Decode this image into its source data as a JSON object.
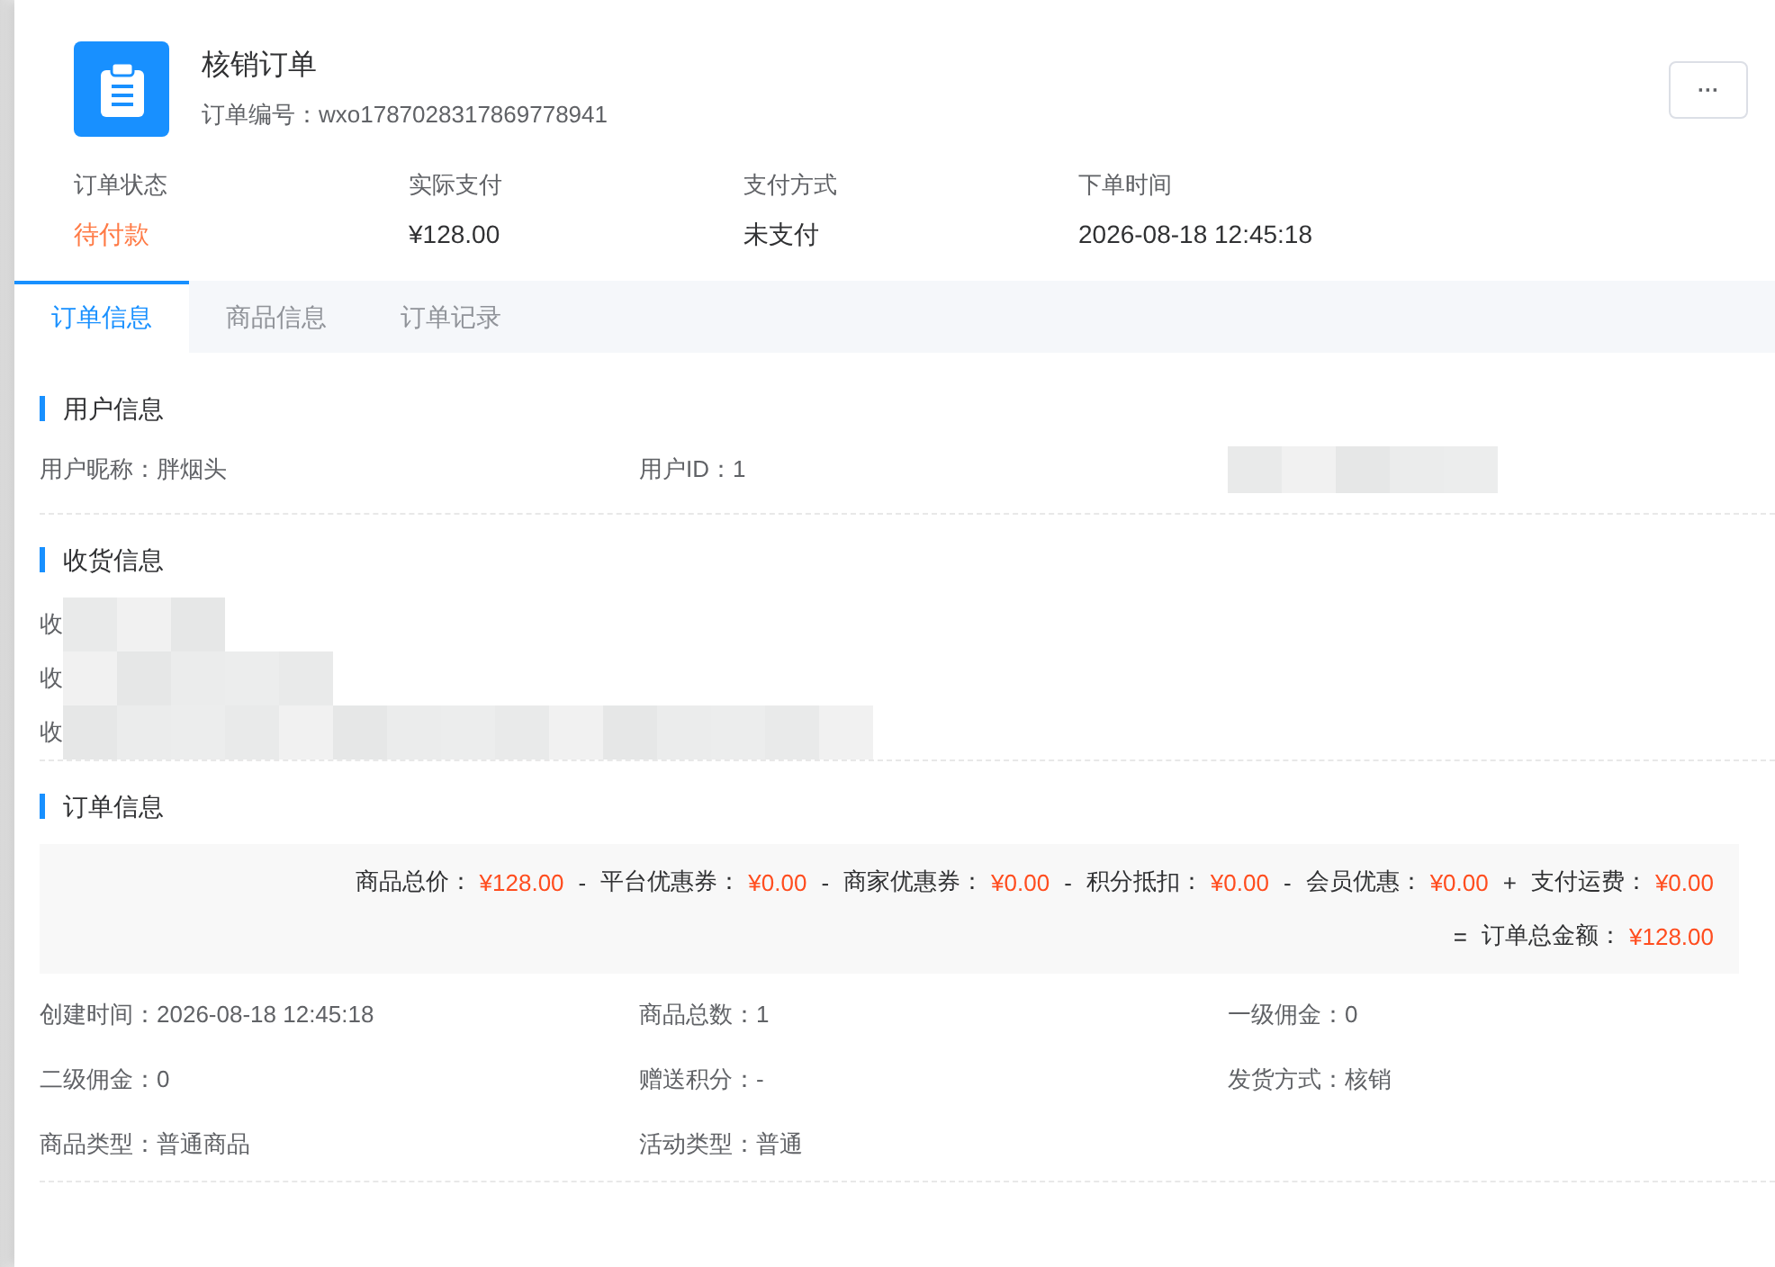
{
  "header": {
    "title": "核销订单",
    "order_no": "订单编号：wxo1787028317869778941",
    "more_button": "···"
  },
  "summary": [
    {
      "label": "订单状态",
      "value": "待付款",
      "kind": "status"
    },
    {
      "label": "实际支付",
      "value": "¥128.00",
      "kind": "plain"
    },
    {
      "label": "支付方式",
      "value": "未支付",
      "kind": "plain"
    },
    {
      "label": "下单时间",
      "value": "2026-08-18 12:45:18",
      "kind": "plain"
    }
  ],
  "tabs": [
    {
      "label": "订单信息",
      "selected": true
    },
    {
      "label": "商品信息",
      "selected": false
    },
    {
      "label": "订单记录",
      "selected": false
    }
  ],
  "user_section": {
    "title": "用户信息",
    "fields": [
      "用户昵称：胖烟头",
      "用户ID：1"
    ]
  },
  "shipping_section": {
    "title": "收货信息",
    "rows": [
      "收",
      "收",
      "收"
    ]
  },
  "order_section": {
    "title": "订单信息",
    "fees": [
      {
        "label": "商品总价：",
        "value": "¥128.00"
      },
      {
        "op": "-",
        "label": "平台优惠券：",
        "value": "¥0.00"
      },
      {
        "op": "-",
        "label": "商家优惠券：",
        "value": "¥0.00"
      },
      {
        "op": "-",
        "label": "积分抵扣：",
        "value": "¥0.00"
      },
      {
        "op": "-",
        "label": "会员优惠：",
        "value": "¥0.00"
      },
      {
        "op": "+",
        "label": "支付运费：",
        "value": "¥0.00"
      }
    ],
    "total": {
      "op": "=",
      "label": "订单总金额：",
      "value": "¥128.00"
    },
    "fields": [
      "创建时间：2026-08-18 12:45:18",
      "商品总数：1",
      "一级佣金：0",
      "二级佣金：0",
      "赠送积分：-",
      "发货方式：核销",
      "商品类型：普通商品",
      "活动类型：普通"
    ]
  }
}
